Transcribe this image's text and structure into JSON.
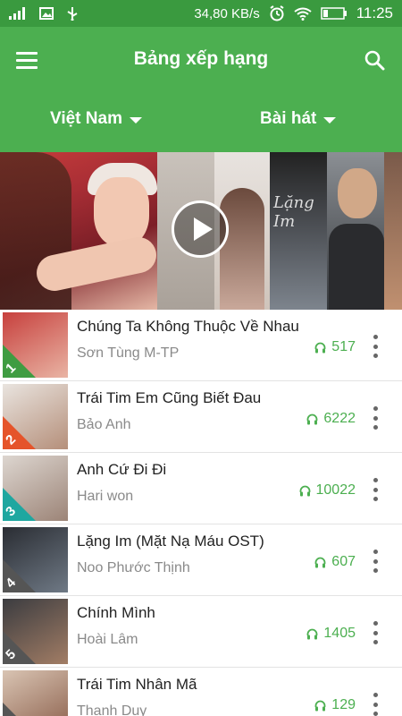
{
  "status_bar": {
    "network_speed": "34,80 KB/s",
    "time": "11:25",
    "icons": [
      "signal-icon",
      "image-icon",
      "usb-icon",
      "alarm-icon",
      "wifi-icon",
      "battery-icon"
    ]
  },
  "header": {
    "title": "Bảng xếp hạng",
    "country_dropdown": "Việt Nam",
    "type_dropdown": "Bài hát"
  },
  "banner": {
    "panel_text": "Lặng Im",
    "play_icon": "play-icon"
  },
  "rank_colors": [
    "#3f9c42",
    "#e5542a",
    "#1ea7a0",
    "#555555",
    "#555555",
    "#555555"
  ],
  "songs": [
    {
      "rank": "1",
      "title": "Chúng Ta Không Thuộc Về Nhau",
      "artist": "Sơn Tùng M-TP",
      "listens": "517",
      "thumb_colors": [
        "#c7403d",
        "#e9b4a4"
      ]
    },
    {
      "rank": "2",
      "title": "Trái Tim Em Cũng Biết Đau",
      "artist": "Bảo Anh",
      "listens": "6222",
      "thumb_colors": [
        "#e9e4df",
        "#b58f7a"
      ]
    },
    {
      "rank": "3",
      "title": "Anh Cứ Đi Đi",
      "artist": "Hari won",
      "listens": "10022",
      "thumb_colors": [
        "#ddd6d0",
        "#9c8477"
      ]
    },
    {
      "rank": "4",
      "title": "Lặng Im (Mặt Nạ Máu OST)",
      "artist": "Noo Phước Thịnh",
      "listens": "607",
      "thumb_colors": [
        "#2a2d33",
        "#6f7985"
      ]
    },
    {
      "rank": "5",
      "title": "Chính Mình",
      "artist": "Hoài Lâm",
      "listens": "1405",
      "thumb_colors": [
        "#3b3c40",
        "#a27d65"
      ]
    },
    {
      "rank": "",
      "title": "Trái Tim Nhân Mã",
      "artist": "Thanh Duy",
      "listens": "129",
      "thumb_colors": [
        "#d9c4b3",
        "#8a5e4a"
      ]
    }
  ]
}
